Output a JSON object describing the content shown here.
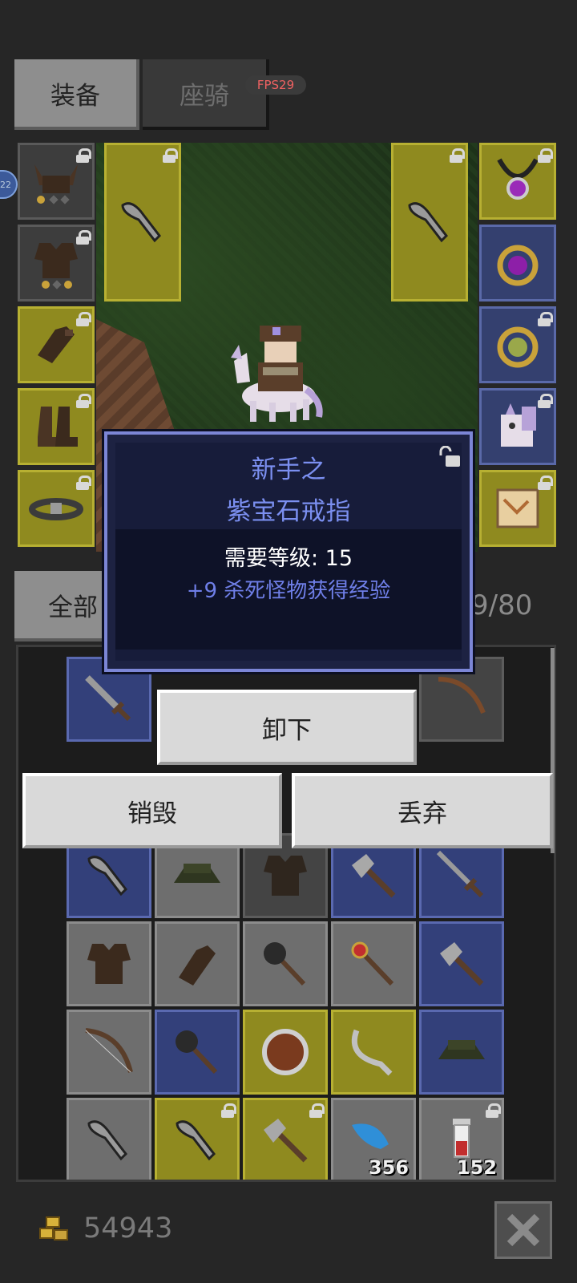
{
  "tabs": {
    "equipment": "装备",
    "mount": "座骑"
  },
  "fps": "FPS29",
  "level_badge": "22",
  "filter": {
    "all": "全部"
  },
  "capacity": "9/80",
  "tooltip": {
    "name_line1": "新手之",
    "name_line2": "紫宝石戒指",
    "requirement": "需要等级: 15",
    "bonus": "+9 杀死怪物获得经验"
  },
  "actions": {
    "unequip": "卸下",
    "destroy": "销毁",
    "discard": "丢弃"
  },
  "stacks": {
    "feather": "356",
    "potion": "152"
  },
  "gold": "54943",
  "icons": {
    "helmet": "horned-helmet-icon",
    "armor": "leather-armor-icon",
    "gloves": "gloves-icon",
    "boots": "boots-icon",
    "belt": "belt-icon",
    "weapon": "club-icon",
    "necklace": "amulet-icon",
    "ring1": "purple-ring-icon",
    "ring2": "green-ring-icon",
    "pet": "unicorn-icon",
    "map": "map-scroll-icon",
    "close": "close-icon",
    "gold": "gold-coins-icon"
  },
  "colors": {
    "tooltip_title": "#7b8ff0",
    "fps": "#f06262",
    "rare_slot": "#8f8a1f",
    "magic_slot": "#33407a"
  }
}
